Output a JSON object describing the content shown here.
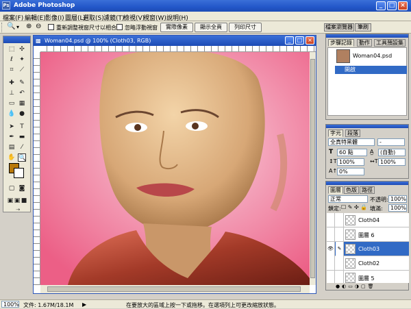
{
  "app": {
    "title": "Adobe Photoshop"
  },
  "menu": [
    "檔案(F)",
    "編輯(E)",
    "影像(I)",
    "圖層(L)",
    "選取(S)",
    "濾鏡(T)",
    "檢視(V)",
    "視窗(W)",
    "說明(H)"
  ],
  "options": {
    "resize_window": "重新調整視窗尺寸以相合",
    "ignore_palettes": "忽略浮動視窗",
    "actual_pixels": "實際像素",
    "fit_screen": "顯示全頁",
    "print_size": "列印尺寸"
  },
  "palette_well": {
    "tab1": "檔案瀏覽器",
    "tab2": "筆刷"
  },
  "document": {
    "title": "Woman04.psd @ 100% (Cloth03, RGB)"
  },
  "history_panel": {
    "tabs": [
      "步驟記錄",
      "動作",
      "工具預設集"
    ],
    "snapshot": "Woman04.psd",
    "step": "開啟"
  },
  "character_panel": {
    "tabs": [
      "字元",
      "段落"
    ],
    "font": "全真特黑體",
    "style": "-",
    "size": "60 點",
    "leading": "(自動)",
    "vscale": "100%",
    "hscale": "100%",
    "baseline": "0%"
  },
  "layers_panel": {
    "tabs": [
      "圖層",
      "色版",
      "路徑"
    ],
    "blend_mode": "正常",
    "opacity_label": "不透明:",
    "opacity": "100%",
    "lock_label": "鎖定:",
    "fill_label": "填滿:",
    "fill": "100%",
    "layers": [
      "Cloth04",
      "圖層 6",
      "Cloth03",
      "Cloth02",
      "圖層 5"
    ]
  },
  "status": {
    "zoom": "100%",
    "doc_info": "文件: 1.67M/18.1M",
    "hint": "在要放大的區域上按一下或拖移。在選項列上可更改縮放狀態。"
  },
  "colors": {
    "foreground": "#b87809",
    "background": "#ffffff",
    "accent": "#316ac5"
  },
  "icons": [
    "photoshop-logo",
    "zoom-tool-icon",
    "eye-icon",
    "brush-icon",
    "new-layer-icon",
    "trash-icon"
  ]
}
